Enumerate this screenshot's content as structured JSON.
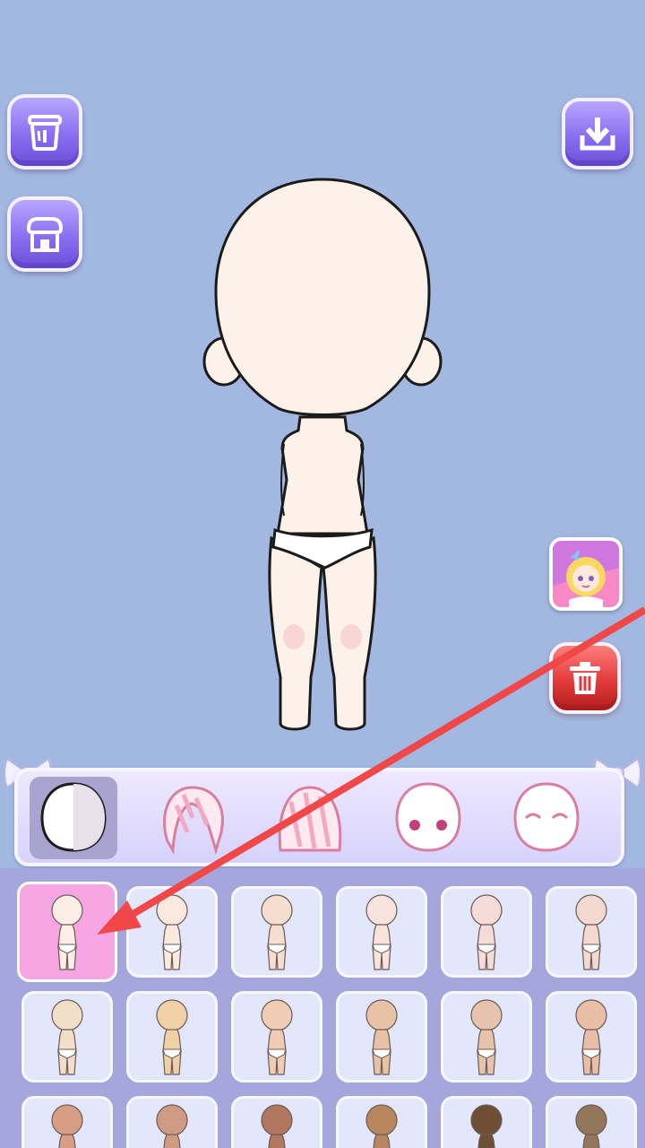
{
  "toolbar": {
    "delete_icon": "trash-bin-icon",
    "shop_icon": "shop-icon",
    "download_icon": "download-icon",
    "clear_icon": "trash-can-icon"
  },
  "colors": {
    "background": "#a3b8e0",
    "button_purple": "#8a6ef0",
    "button_red": "#e23a3a",
    "selected_cell": "#f7a6e4",
    "arrow": "#f04848"
  },
  "categories": [
    {
      "name": "body",
      "icon": "body-icon",
      "active": true
    },
    {
      "name": "front-hair",
      "icon": "front-hair-icon",
      "active": false
    },
    {
      "name": "back-hair",
      "icon": "back-hair-icon",
      "active": false
    },
    {
      "name": "eyes",
      "icon": "eyes-icon",
      "active": false
    },
    {
      "name": "face",
      "icon": "face-icon",
      "active": false
    }
  ],
  "skin_tones": [
    "#fbeee6",
    "#fbe9df",
    "#f5ddd0",
    "#f8e4dc",
    "#f6dcd9",
    "#f3d9d0",
    "#f3dfc9",
    "#f0d0a6",
    "#eecdb4",
    "#e8c2a4",
    "#e6c3ad",
    "#e8bfa6",
    "#d89e85",
    "#cf9b84",
    "#b27760",
    "#b7865f",
    "#6e4f35",
    "#94775a"
  ],
  "selected_index": 0
}
